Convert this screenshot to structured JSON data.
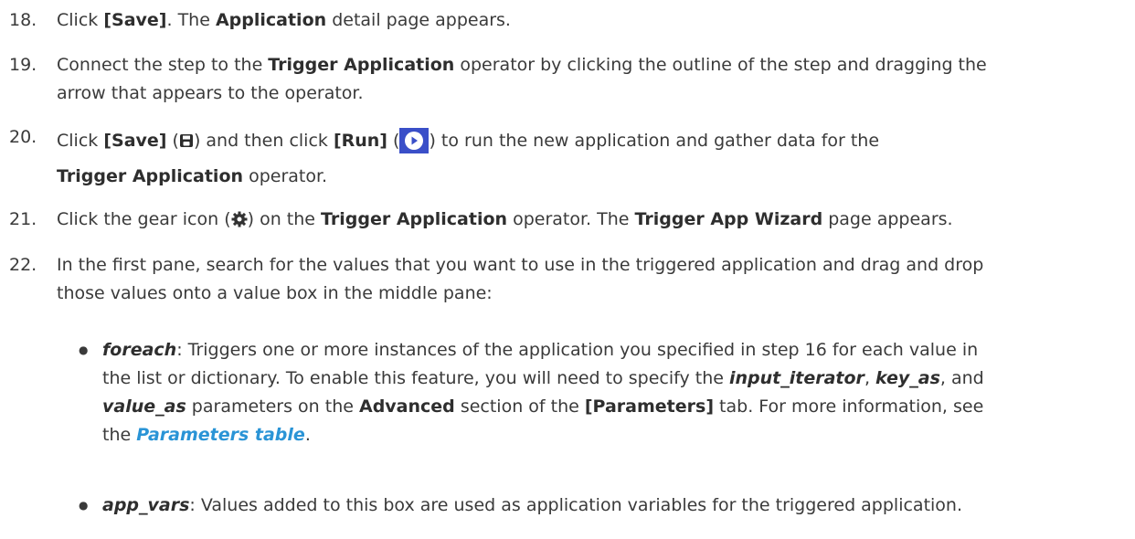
{
  "steps": [
    {
      "num": "18.",
      "p1": "Click ",
      "b1": "[Save]",
      "p2": ". The ",
      "b2": "Application",
      "p3": " detail page appears."
    },
    {
      "num": "19.",
      "p1": "Connect the step to the ",
      "b1": "Trigger Application",
      "p2": " operator by clicking the outline of the step and dragging the",
      "line2": "arrow that appears to the operator."
    },
    {
      "num": "20.",
      "p1": "Click ",
      "b1": "[Save]",
      "p2": " (",
      "p3": ") and then click ",
      "b2": "[Run]",
      "p4": " (",
      "p5": ") to run the new application and gather data for the",
      "b3": "Trigger Application",
      "p6": " operator."
    },
    {
      "num": "21.",
      "p1": "Click the gear icon (",
      "p2": ") on the ",
      "b1": "Trigger Application",
      "p3": " operator. The ",
      "b2": "Trigger App Wizard",
      "p4": " page appears."
    },
    {
      "num": "22.",
      "line1": "In the first pane, search for the values that you want to use in the triggered application and drag and drop",
      "line2": "those values onto a value box in the middle pane:"
    }
  ],
  "bullets": [
    {
      "dot": "●",
      "term": "foreach",
      "p1": ": Triggers one or more instances of the application you specified in step 16 for each value in",
      "p2": "the list or dictionary. To enable this feature, you will need to specify the ",
      "i1": "input_iterator",
      "p3": ", ",
      "i2": "key_as",
      "p4": ", and",
      "i3": "value_as",
      "p5": " parameters on the ",
      "b1": "Advanced",
      "p6": " section of the ",
      "b2": "[Parameters]",
      "p7": " tab. For more information, see",
      "p8": "the ",
      "link": "Parameters table",
      "p9": "."
    },
    {
      "dot": "●",
      "term": "app_vars",
      "p1": ": Values added to this box are used as application variables for the triggered application."
    }
  ],
  "icons": {
    "save": "floppy-disk-icon",
    "run": "play-icon",
    "gear": "gear-icon",
    "run_color": "#3a4fc8"
  }
}
